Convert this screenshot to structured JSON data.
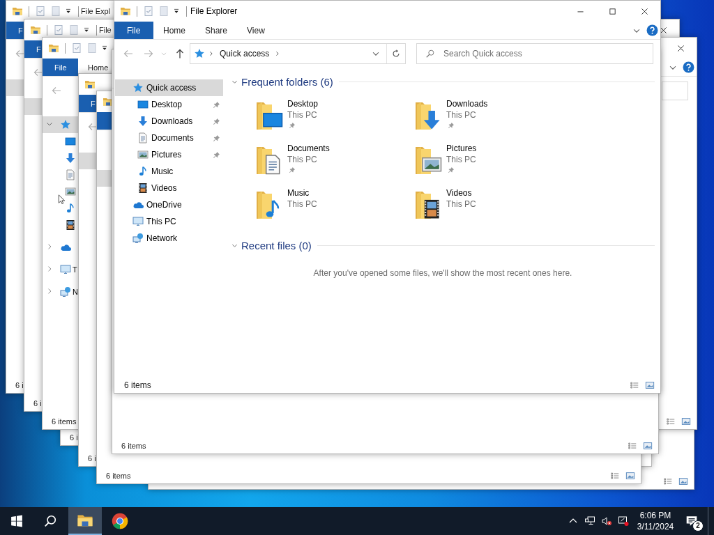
{
  "background_windows": [
    {
      "parts": [
        {
          "kind": "folder"
        },
        {
          "kind": "quick_toolbar"
        },
        {
          "kind": "file_tab_cut"
        },
        {
          "kind": "back"
        }
      ],
      "title": "File Expl",
      "tab_label": "F",
      "tree": [
        {
          "selected": true
        }
      ],
      "status": "6 i"
    },
    {
      "parts": [
        {
          "kind": "folder"
        },
        {
          "kind": "quick_toolbar"
        },
        {
          "kind": "close"
        },
        {
          "kind": "file_tab_cut"
        },
        {
          "kind": "back"
        }
      ],
      "title": "File",
      "tab_label": "F",
      "tree": [
        {
          "selected": true
        }
      ],
      "status": "6 i"
    },
    {
      "parts": [
        {
          "kind": "folder"
        },
        {
          "kind": "quick_toolbar"
        },
        {
          "kind": "close"
        },
        {
          "kind": "file_tab"
        },
        {
          "kind": "help"
        },
        {
          "kind": "back"
        },
        {
          "kind": "search"
        },
        {
          "kind": "views"
        }
      ],
      "tab_label": "File",
      "home_tab": "Home",
      "tree": [
        {
          "kind": "star",
          "selected": true,
          "expanded": true,
          "children": [
            {
              "kind": "desktop",
              "selected": false
            },
            {
              "kind": "downloads",
              "selected": false
            },
            {
              "kind": "documents",
              "selected": false
            },
            {
              "kind": "pictures",
              "selected": false
            },
            {
              "kind": "music",
              "selected": false
            },
            {
              "kind": "videos",
              "selected": false
            }
          ]
        },
        {
          "kind": "onedrive",
          "selected": false,
          "expanded": false
        },
        {
          "kind": "thispc",
          "label": "T",
          "selected": false,
          "expanded": false
        },
        {
          "kind": "network",
          "label": "N",
          "selected": false,
          "expanded": false
        }
      ],
      "status": "6 items"
    },
    {
      "parts": [
        {
          "kind": "folder"
        },
        {
          "kind": "file_tab_cut"
        },
        {
          "kind": "back"
        }
      ],
      "tab_label": "F",
      "tree": [
        {
          "selected": true
        }
      ],
      "status": "6 i"
    },
    {
      "parts": [
        {
          "kind": "folder"
        },
        {
          "kind": "file_tab_cut"
        },
        {
          "kind": "views"
        }
      ],
      "tree": [
        {
          "selected": true
        }
      ],
      "status": "6 items"
    },
    {
      "status": "6 i"
    },
    {
      "parts": [
        {
          "kind": "views"
        }
      ],
      "status": "6 items"
    },
    {
      "parts": [
        {
          "kind": "views"
        }
      ]
    }
  ],
  "window": {
    "title": "File Explorer",
    "ribbon_tabs": [
      {
        "label": "File",
        "selected": true
      },
      {
        "label": "Home",
        "selected": false
      },
      {
        "label": "Share",
        "selected": false
      },
      {
        "label": "View",
        "selected": false
      }
    ],
    "address": {
      "location": "Quick access"
    },
    "search": {
      "placeholder": "Search Quick access"
    },
    "sidebar": [
      {
        "kind": "star",
        "label": "Quick access",
        "selected": true,
        "children": [
          {
            "kind": "desktop",
            "label": "Desktop",
            "selected": false,
            "pinned": true
          },
          {
            "kind": "downloads",
            "label": "Downloads",
            "selected": false,
            "pinned": true
          },
          {
            "kind": "documents",
            "label": "Documents",
            "selected": false,
            "pinned": true
          },
          {
            "kind": "pictures",
            "label": "Pictures",
            "selected": false,
            "pinned": true
          },
          {
            "kind": "music",
            "label": "Music",
            "selected": false
          },
          {
            "kind": "videos",
            "label": "Videos",
            "selected": false
          }
        ]
      },
      {
        "kind": "onedrive",
        "label": "OneDrive",
        "selected": false
      },
      {
        "kind": "thispc",
        "label": "This PC",
        "selected": false
      },
      {
        "kind": "network",
        "label": "Network",
        "selected": false
      }
    ],
    "sections": [
      {
        "title": "Frequent folders (6)",
        "expanded": true,
        "folders": [
          {
            "name": "Desktop",
            "location": "This PC",
            "kind": "desktop",
            "pinned": true
          },
          {
            "name": "Downloads",
            "location": "This PC",
            "kind": "downloads",
            "pinned": true
          },
          {
            "name": "Documents",
            "location": "This PC",
            "kind": "documents",
            "pinned": true
          },
          {
            "name": "Pictures",
            "location": "This PC",
            "kind": "pictures",
            "pinned": true
          },
          {
            "name": "Music",
            "location": "This PC",
            "kind": "music"
          },
          {
            "name": "Videos",
            "location": "This PC",
            "kind": "videos"
          }
        ]
      },
      {
        "title": "Recent files (0)",
        "expanded": true,
        "message": "After you've opened some files, we'll show the most recent ones here."
      }
    ],
    "status_bar": {
      "text": "6 items"
    }
  },
  "taskbar": {
    "apps": [
      {
        "kind": "explorer",
        "active": true
      },
      {
        "kind": "browser",
        "active": false
      }
    ],
    "clock": {
      "time": "6:06 PM",
      "date": "3/11/2024"
    },
    "notifications": {
      "count": "2"
    }
  }
}
